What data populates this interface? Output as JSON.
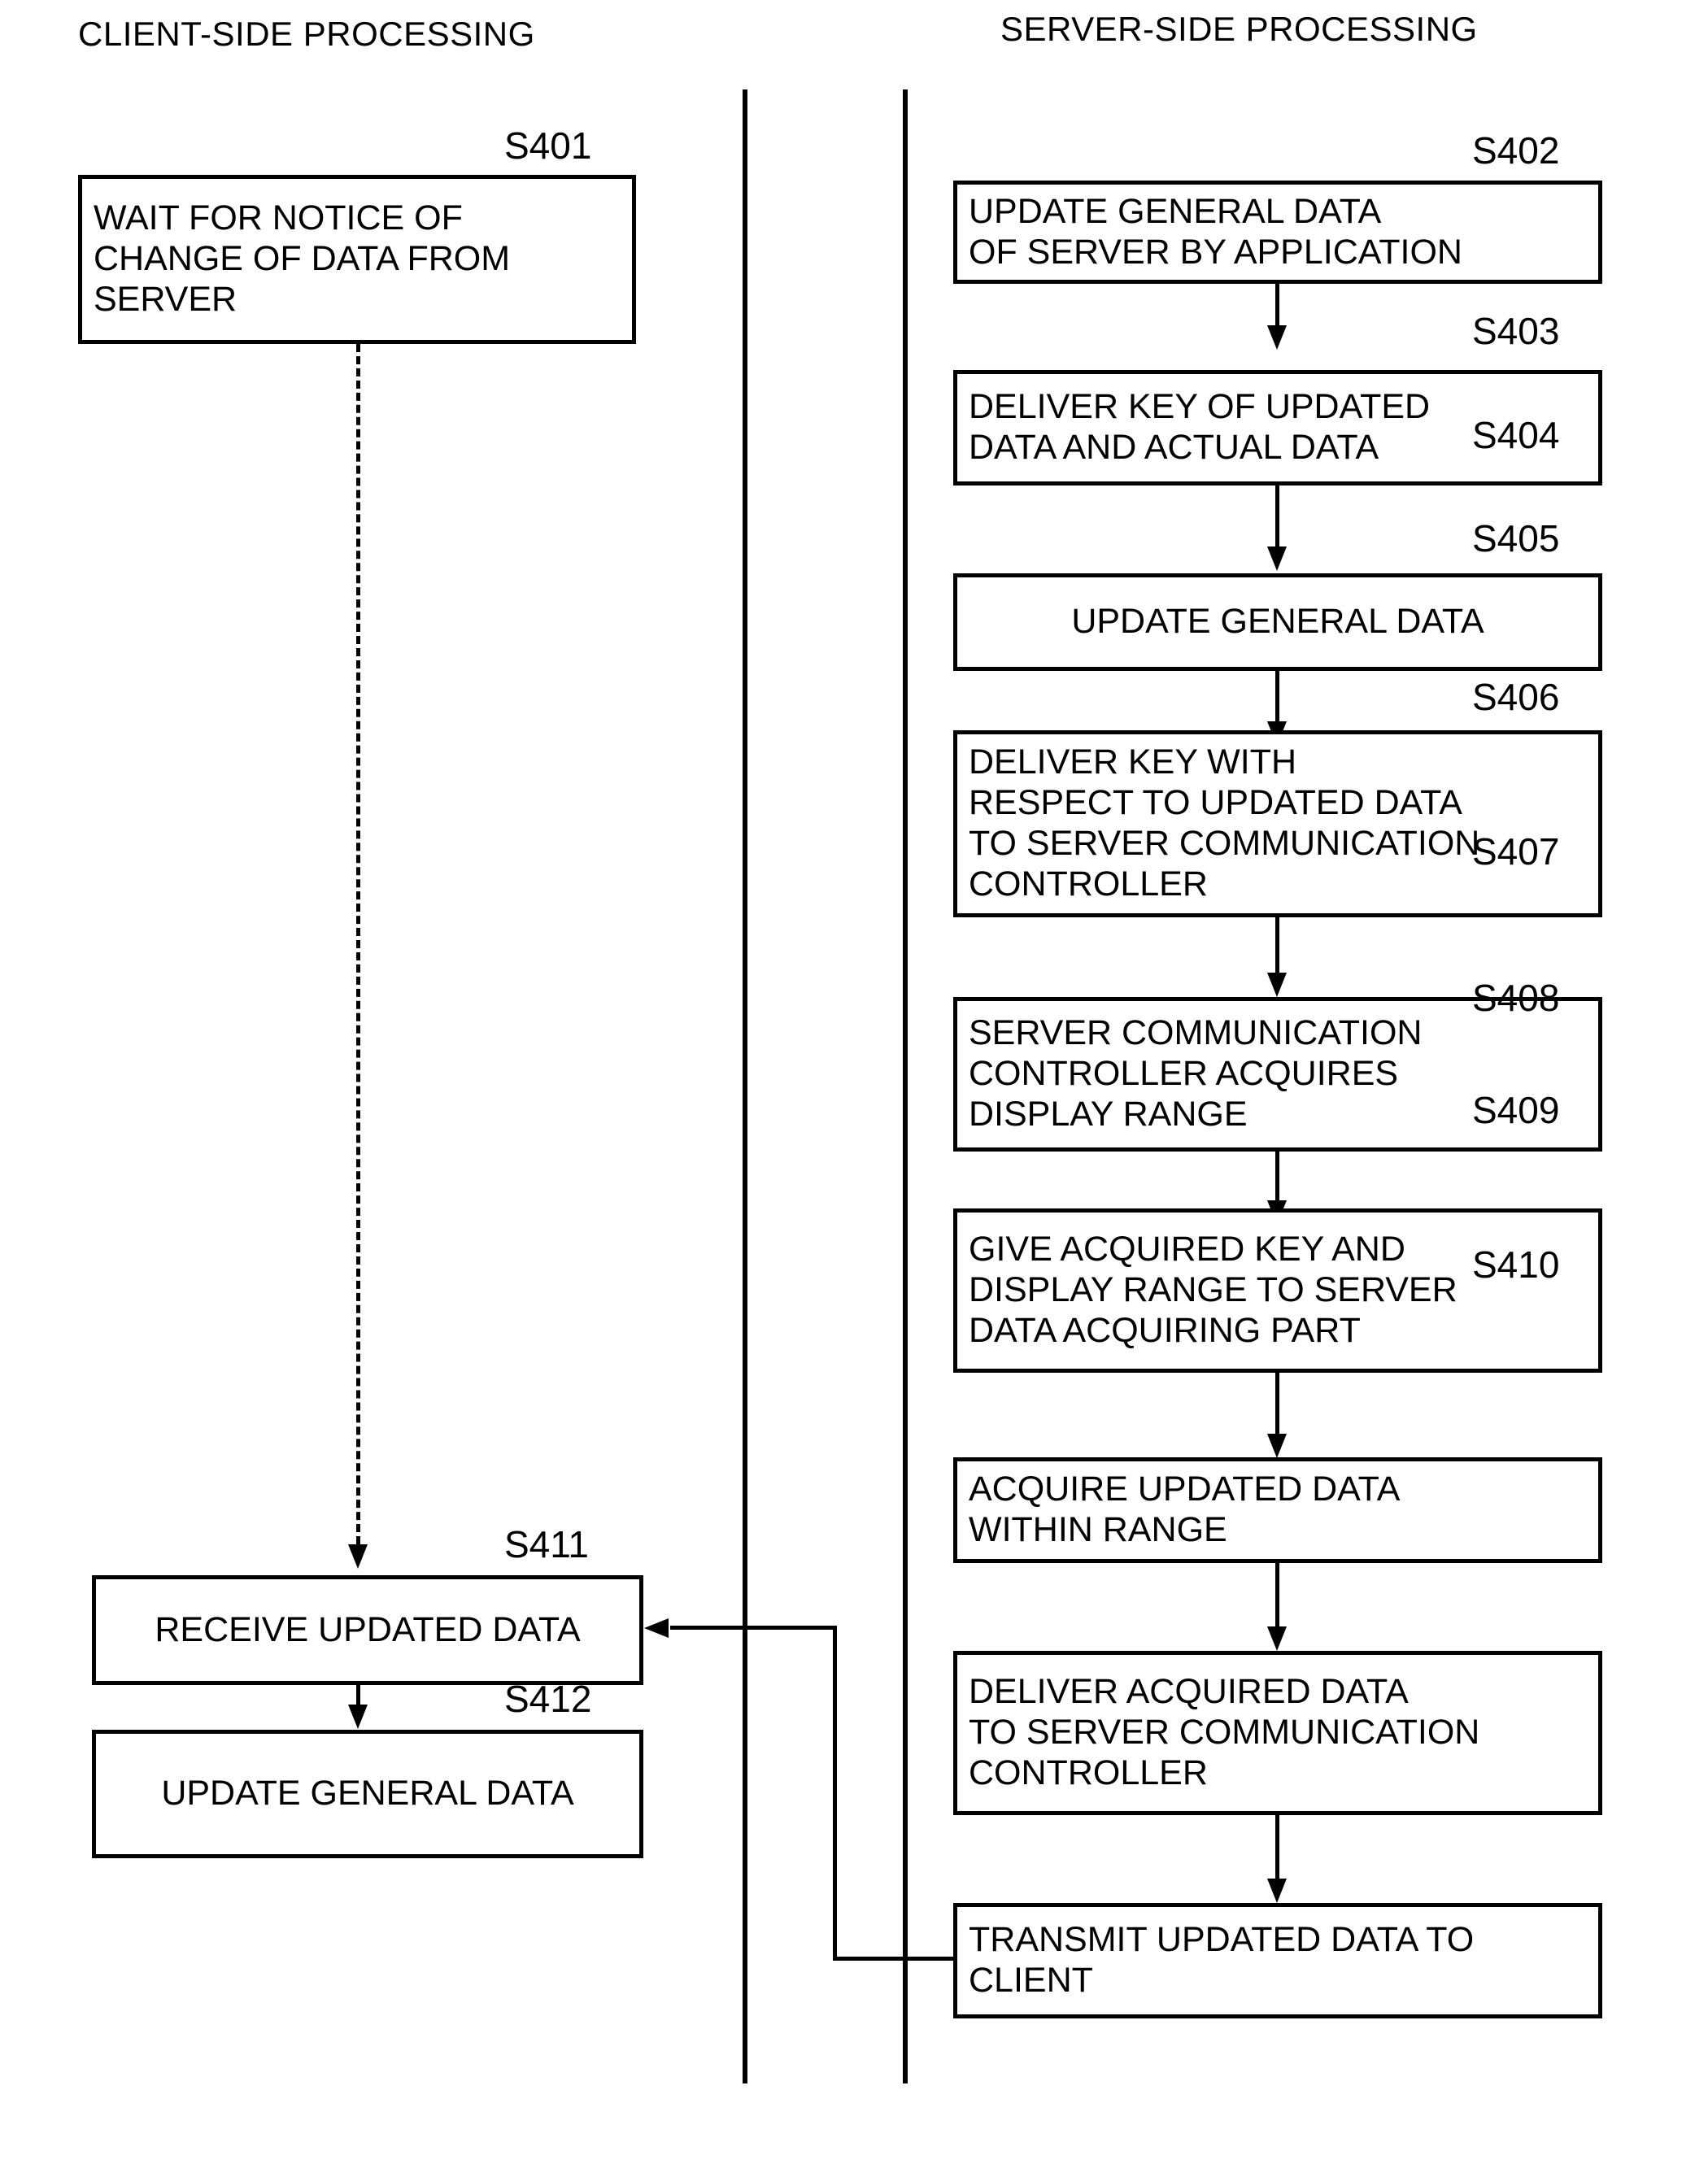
{
  "figure": {
    "type": "flowchart",
    "orientation": "two-column-swimlane"
  },
  "headings": {
    "client": "CLIENT-SIDE PROCESSING",
    "server": "SERVER-SIDE PROCESSING"
  },
  "client_steps": [
    {
      "id": "S401",
      "text": "WAIT FOR NOTICE OF\nCHANGE OF DATA FROM\nSERVER",
      "align": "left"
    },
    {
      "id": "S411",
      "text": "RECEIVE UPDATED DATA",
      "align": "center"
    },
    {
      "id": "S412",
      "text": "UPDATE GENERAL DATA",
      "align": "center"
    }
  ],
  "server_steps": [
    {
      "id": "S402",
      "text": "UPDATE GENERAL DATA\nOF SERVER BY APPLICATION",
      "align": "left"
    },
    {
      "id": "S403",
      "text": "DELIVER KEY OF UPDATED\nDATA AND ACTUAL DATA",
      "align": "left"
    },
    {
      "id": "S404",
      "text": "UPDATE GENERAL DATA",
      "align": "center"
    },
    {
      "id": "S405",
      "text": "DELIVER KEY WITH\nRESPECT TO UPDATED DATA\nTO SERVER COMMUNICATION\nCONTROLLER",
      "align": "left"
    },
    {
      "id": "S406",
      "text": "SERVER COMMUNICATION\nCONTROLLER ACQUIRES\nDISPLAY RANGE",
      "align": "left"
    },
    {
      "id": "S407",
      "text": "GIVE ACQUIRED KEY AND\nDISPLAY RANGE TO SERVER\nDATA ACQUIRING PART",
      "align": "left"
    },
    {
      "id": "S408",
      "text": "ACQUIRE UPDATED DATA\nWITHIN RANGE",
      "align": "left"
    },
    {
      "id": "S409",
      "text": "DELIVER ACQUIRED DATA\nTO SERVER  COMMUNICATION\nCONTROLLER",
      "align": "left"
    },
    {
      "id": "S410",
      "text": "TRANSMIT UPDATED DATA TO\nCLIENT",
      "align": "left"
    }
  ],
  "colors": {
    "ink": "#000000",
    "paper": "#ffffff"
  }
}
